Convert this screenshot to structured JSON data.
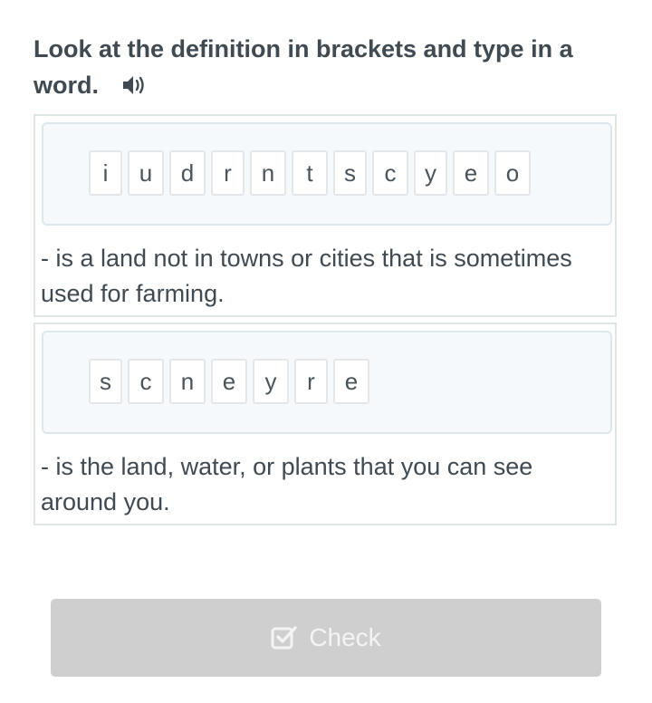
{
  "instruction": {
    "text": "Look at the definition in brackets and type in a word.",
    "audio_icon": "speaker-icon"
  },
  "questions": [
    {
      "letters": [
        "i",
        "u",
        "d",
        "r",
        "n",
        "t",
        "s",
        "c",
        "y",
        "e",
        "o"
      ],
      "definition": "- is a land not in towns or cities that is sometimes used for farming."
    },
    {
      "letters": [
        "s",
        "c",
        "n",
        "e",
        "y",
        "r",
        "e"
      ],
      "definition": "- is the land, water, or plants that you can see around you."
    }
  ],
  "check_button": {
    "label": "Check",
    "icon": "checkbox-icon",
    "state": "disabled",
    "color": "#cfcfcf"
  }
}
